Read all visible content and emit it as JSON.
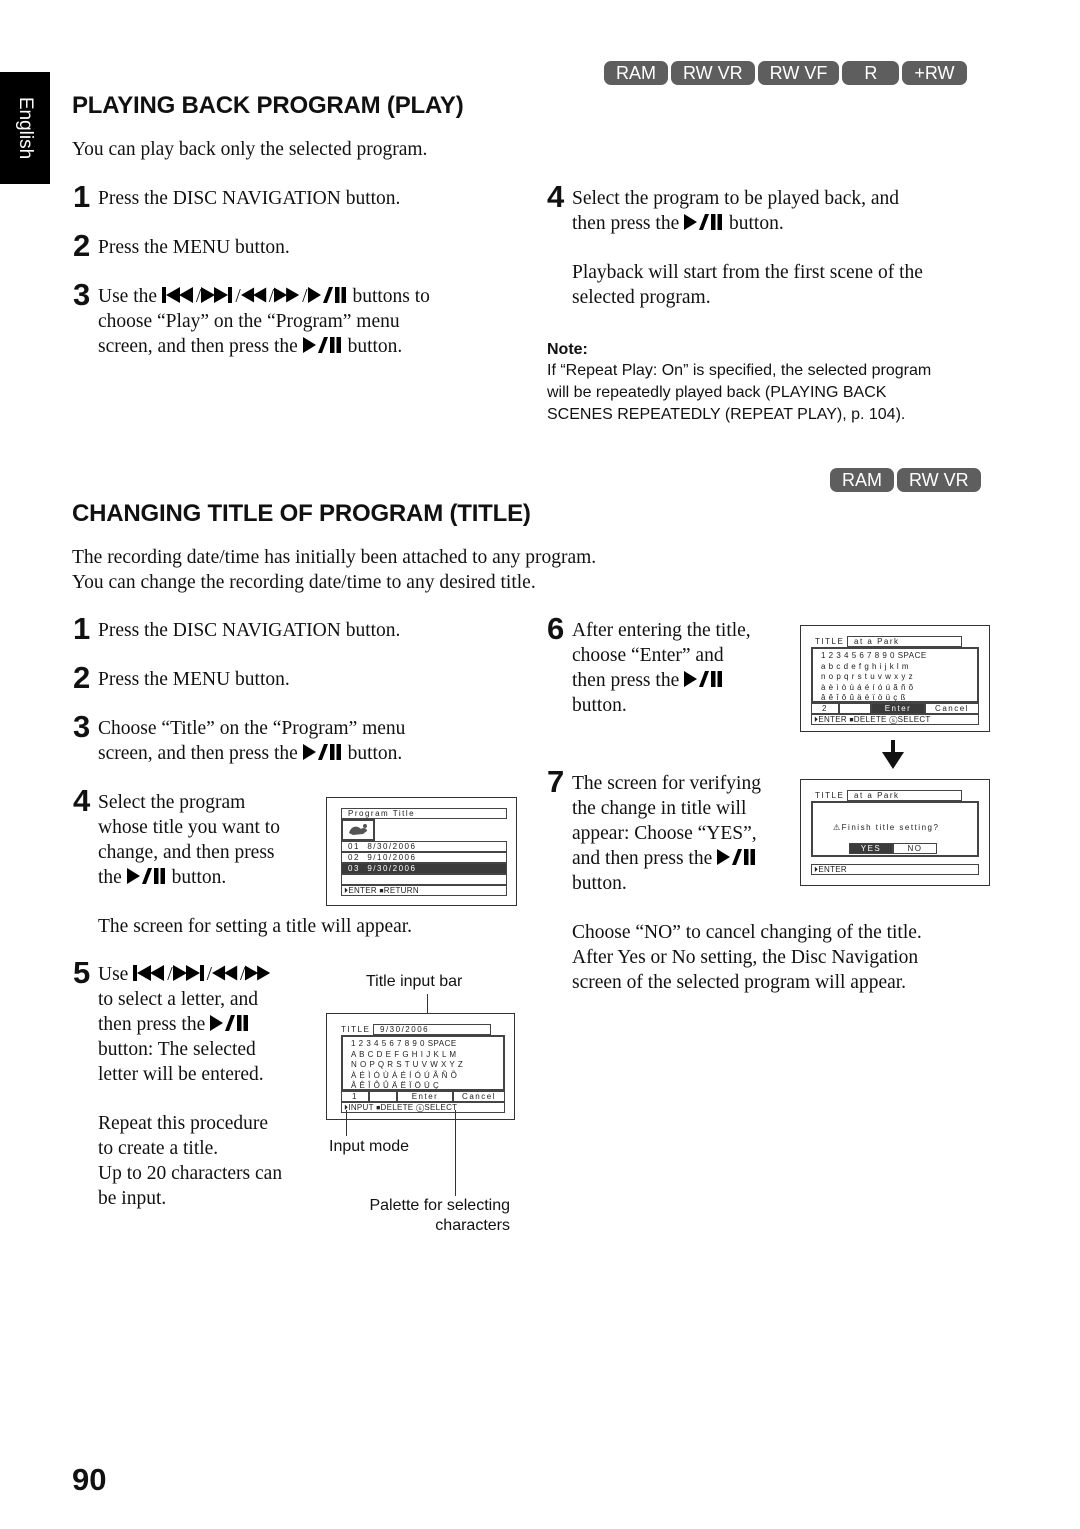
{
  "side_tab": "English",
  "page_number": "90",
  "icons": {
    "prev": "skip-previous-icon",
    "next": "skip-next-icon",
    "rew": "rewind-icon",
    "ff": "fast-forward-icon",
    "playpause": "play-pause-icon"
  },
  "section1": {
    "badges": [
      "RAM",
      "RW VR",
      "RW VF",
      "R",
      "+RW"
    ],
    "title": "PLAYING BACK PROGRAM (PLAY)",
    "intro": "You can play back only the selected program.",
    "steps": [
      {
        "num": "1",
        "text": "Press the DISC NAVIGATION button."
      },
      {
        "num": "2",
        "text": "Press the MENU button."
      },
      {
        "num": "3",
        "pre": "Use the",
        "mid": "buttons to",
        "line2": "choose “Play” on the “Program” menu",
        "line3a": "screen, and then press the",
        "line3b": "button."
      },
      {
        "num": "4",
        "line1": "Select the program to be played back, and",
        "line2a": "then press the",
        "line2b": "button.",
        "para": "Playback will start from the first scene of the selected program."
      }
    ],
    "note": {
      "title": "Note:",
      "lines": [
        "If “Repeat Play: On” is specified, the selected program",
        "will be repeatedly played back (PLAYING BACK",
        "SCENES REPEATEDLY (REPEAT PLAY), p. 104)."
      ]
    }
  },
  "section2": {
    "badges": [
      "RAM",
      "RW VR"
    ],
    "title": "CHANGING TITLE OF PROGRAM (TITLE)",
    "intro": [
      "The recording date/time has initially been attached to any program.",
      "You can change the recording date/time to any desired title."
    ],
    "steps": {
      "s1": {
        "num": "1",
        "text": "Press the DISC NAVIGATION button."
      },
      "s2": {
        "num": "2",
        "text": "Press the MENU button."
      },
      "s3": {
        "num": "3",
        "line1": "Choose “Title” on the “Program” menu",
        "line2a": "screen, and then press the",
        "line2b": "button."
      },
      "s4": {
        "num": "4",
        "lines": [
          "Select the program",
          "whose title you want to",
          "change, and then press"
        ],
        "line4a": "the",
        "line4b": "button.",
        "after": "The screen for setting a title will appear."
      },
      "s5": {
        "num": "5",
        "pre": "Use",
        "lines": [
          "to select a letter, and"
        ],
        "line3a": "then press the",
        "rest": [
          "button: The selected",
          "letter will be entered."
        ],
        "repeat": [
          "Repeat this procedure",
          "to create a title.",
          "Up to 20 characters can",
          "be input."
        ]
      },
      "s6": {
        "num": "6",
        "lines": [
          "After entering the title,",
          "choose “Enter” and"
        ],
        "line3a": "then press the",
        "line4": "button."
      },
      "s7": {
        "num": "7",
        "lines": [
          "The screen for verifying",
          "the change in title will",
          "appear: Choose “YES”,"
        ],
        "line4a": "and then press the",
        "line5": "button.",
        "after": [
          "Choose “NO” to cancel changing of the title.",
          "After Yes or No setting, the Disc Navigation",
          "screen of the selected program will appear."
        ]
      }
    },
    "labels": {
      "title_input_bar": "Title input bar",
      "input_mode": "Input mode",
      "palette": [
        "Palette for selecting",
        "characters"
      ]
    }
  },
  "screens": {
    "program_title": {
      "header": "Program Title",
      "rows": [
        {
          "no": "01",
          "date": "8/30/2006",
          "selected": false
        },
        {
          "no": "02",
          "date": "9/10/2006",
          "selected": false
        },
        {
          "no": "03",
          "date": "9/30/2006",
          "selected": true
        }
      ],
      "footer": [
        "ENTER",
        "RETURN"
      ]
    },
    "title_input_upper": {
      "label": "TITLE",
      "value": "9/30/2006",
      "palette": [
        "1 2 3 4 5 6 7 8 9 0 SPACE",
        "A B C D E F G H I J K L M",
        "N O P Q R S T U V W X Y Z",
        "À É Ì Ó Ù Á É Í Ó Ú Ã Ñ Õ",
        "Â Ê Î Ô Û Ä Ë Ï Ö Ü Ç"
      ],
      "mode": "1",
      "enter": "Enter",
      "cancel": "Cancel",
      "footer": [
        "INPUT",
        "DELETE",
        "SELECT"
      ]
    },
    "title_input_lower": {
      "label": "TITLE",
      "value": "at a Park",
      "palette": [
        "1 2 3 4 5 6 7 8 9 0 SPACE",
        "a b c d e f g h i j k l m",
        "n o p q r s t u v w x y z",
        "à è ì ò ù á é í ó ú ã ñ õ",
        "â ê î ô û ä ë ï ö ü ç ß"
      ],
      "mode": "2",
      "enter": "Enter",
      "cancel": "Cancel",
      "footer": [
        "ENTER",
        "DELETE",
        "SELECT"
      ]
    },
    "confirm": {
      "label": "TITLE",
      "value": "at a Park",
      "message": "Finish title setting?",
      "yes": "YES",
      "no": "NO",
      "footer": "ENTER"
    }
  }
}
